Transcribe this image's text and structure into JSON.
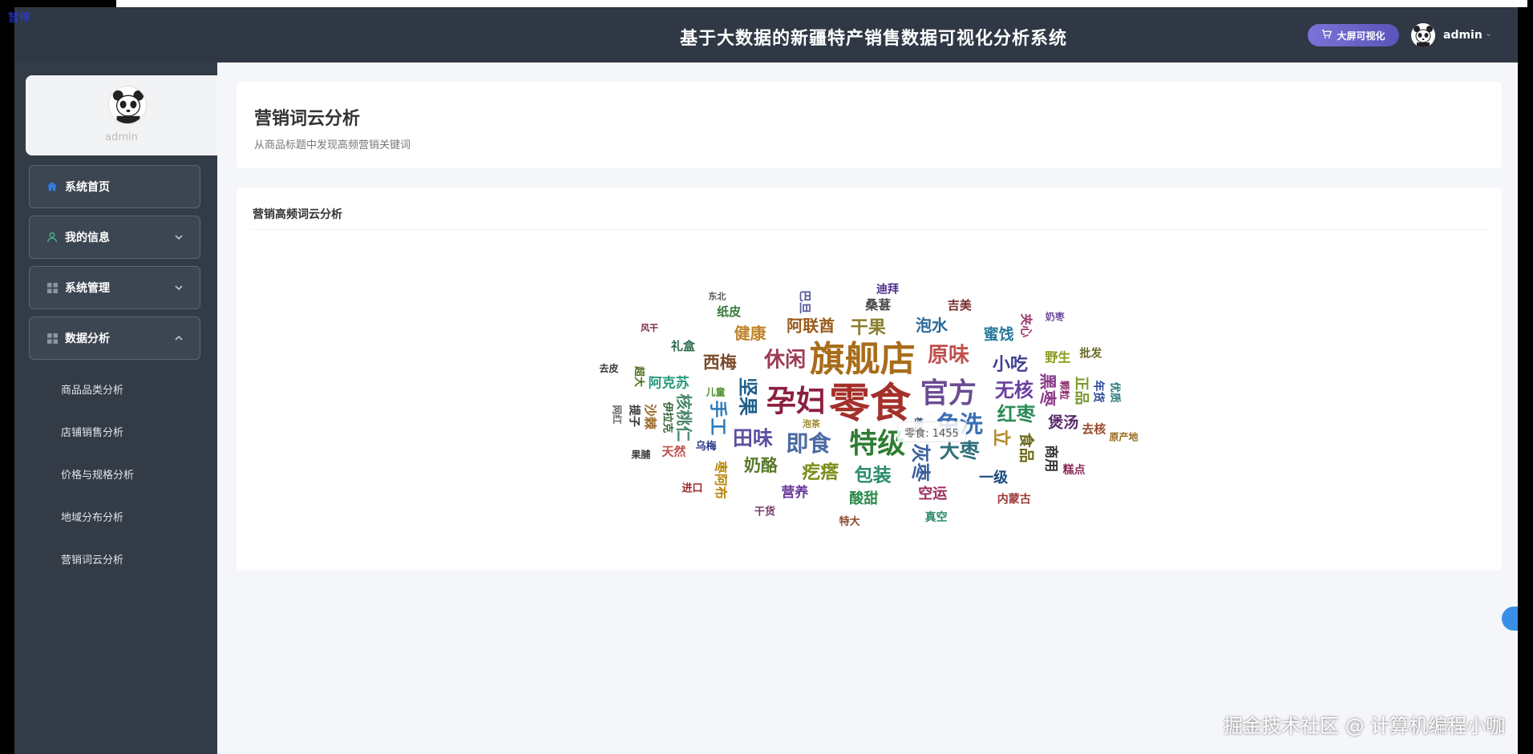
{
  "overlay": {
    "pause_label": "暂停",
    "watermark": "掘金技术社区 @ 计算机编程小咖"
  },
  "header": {
    "title": "基于大数据的新疆特产销售数据可视化分析系统",
    "bigscreen_label": "大屏可视化",
    "username": "admin"
  },
  "sidebar": {
    "profile_name": "admin",
    "menu": [
      {
        "label": "系统首页",
        "icon": "home-icon",
        "active": true
      },
      {
        "label": "我的信息",
        "icon": "user-icon",
        "expanded": false
      },
      {
        "label": "系统管理",
        "icon": "grid-icon",
        "expanded": false
      },
      {
        "label": "数据分析",
        "icon": "grid-icon",
        "expanded": true
      }
    ],
    "submenu": [
      {
        "label": "商品品类分析"
      },
      {
        "label": "店铺销售分析"
      },
      {
        "label": "价格与规格分析"
      },
      {
        "label": "地域分布分析"
      },
      {
        "label": "营销词云分析"
      }
    ]
  },
  "page": {
    "title": "营销词云分析",
    "subtitle": "从商品标题中发现高频营销关键词"
  },
  "section": {
    "title": "营销高频词云分析"
  },
  "tooltip": {
    "text": "零食: 1455"
  },
  "chart_data": {
    "type": "wordcloud",
    "words": [
      {
        "text": "零食",
        "value": 1455,
        "color": "#a4302b"
      },
      {
        "text": "旗舰店",
        "value": 1200,
        "color": "#a86d1a"
      },
      {
        "text": "孕妇",
        "value": 950,
        "color": "#8c1f3f"
      },
      {
        "text": "官方",
        "value": 900,
        "color": "#6a4c93"
      },
      {
        "text": "特级",
        "value": 880,
        "color": "#2e7d32"
      },
      {
        "text": "免洗",
        "value": 700,
        "color": "#3b6fb6"
      },
      {
        "text": "即食",
        "value": 650,
        "color": "#4a6aa3"
      },
      {
        "text": "休闲",
        "value": 600,
        "color": "#9c3d54"
      },
      {
        "text": "原味",
        "value": 580,
        "color": "#c0504d"
      },
      {
        "text": "大枣",
        "value": 560,
        "color": "#2f6f7a"
      },
      {
        "text": "田味",
        "value": 540,
        "color": "#5e4fa2"
      },
      {
        "text": "坚果",
        "value": 530,
        "color": "#1f5f8b"
      },
      {
        "text": "无核",
        "value": 520,
        "color": "#6b3fa0"
      },
      {
        "text": "红枣",
        "value": 510,
        "color": "#2e8b57"
      },
      {
        "text": "灰枣",
        "value": 500,
        "color": "#3a5f9e"
      },
      {
        "text": "包装",
        "value": 480,
        "color": "#2a8c6a"
      },
      {
        "text": "疙瘩",
        "value": 470,
        "color": "#7a8f1a"
      },
      {
        "text": "手工",
        "value": 460,
        "color": "#2b7bbb"
      },
      {
        "text": "干果",
        "value": 450,
        "color": "#8b7d2a"
      },
      {
        "text": "小吃",
        "value": 440,
        "color": "#3f3f8f"
      },
      {
        "text": "立",
        "value": 430,
        "color": "#b08a2a"
      },
      {
        "text": "奶酪",
        "value": 420,
        "color": "#5a7a2a"
      },
      {
        "text": "西梅",
        "value": 410,
        "color": "#7a4a2a"
      },
      {
        "text": "黑枣",
        "value": 400,
        "color": "#8a3a8a"
      },
      {
        "text": "阿联酋",
        "value": 390,
        "color": "#9a5a1a"
      },
      {
        "text": "泡水",
        "value": 380,
        "color": "#2a6a9a"
      },
      {
        "text": "核桃仁",
        "value": 370,
        "color": "#4a8a6a"
      },
      {
        "text": "健康",
        "value": 360,
        "color": "#c0842a"
      },
      {
        "text": "蜜饯",
        "value": 350,
        "color": "#2a7a9a"
      },
      {
        "text": "食品",
        "value": 340,
        "color": "#6a6a1a"
      },
      {
        "text": "煲汤",
        "value": 330,
        "color": "#5a2a6a"
      },
      {
        "text": "一级",
        "value": 320,
        "color": "#1a4a7a"
      },
      {
        "text": "正品",
        "value": 310,
        "color": "#7a9a2a"
      },
      {
        "text": "空运",
        "value": 300,
        "color": "#9a2a5a"
      },
      {
        "text": "酸甜",
        "value": 290,
        "color": "#2a8a4a"
      },
      {
        "text": "商用",
        "value": 280,
        "color": "#333333"
      },
      {
        "text": "营养",
        "value": 270,
        "color": "#6a3a9a"
      },
      {
        "text": "阿克苏",
        "value": 260,
        "color": "#2a9a7a"
      },
      {
        "text": "枣阿布",
        "value": 250,
        "color": "#b8860b"
      },
      {
        "text": "桑葚",
        "value": 240,
        "color": "#4a4a4a"
      },
      {
        "text": "野生",
        "value": 230,
        "color": "#8a9a1a"
      },
      {
        "text": "沙棘",
        "value": 220,
        "color": "#9a6a2a"
      },
      {
        "text": "天然",
        "value": 215,
        "color": "#c0504d"
      },
      {
        "text": "礼盒",
        "value": 210,
        "color": "#2a6a4a"
      },
      {
        "text": "巴旦",
        "value": 205,
        "color": "#5a5a9a"
      },
      {
        "text": "吉美",
        "value": 200,
        "color": "#7a2a2a"
      },
      {
        "text": "去核",
        "value": 195,
        "color": "#9a4a2a"
      },
      {
        "text": "夹心",
        "value": 190,
        "color": "#a03a6a"
      },
      {
        "text": "纸皮",
        "value": 185,
        "color": "#3a7a3a"
      },
      {
        "text": "迪拜",
        "value": 180,
        "color": "#4a2a8a"
      },
      {
        "text": "年货",
        "value": 175,
        "color": "#2a4a9a"
      },
      {
        "text": "批发",
        "value": 170,
        "color": "#6a6a2a"
      },
      {
        "text": "内蒙古",
        "value": 165,
        "color": "#9a3a3a"
      },
      {
        "text": "提子",
        "value": 160,
        "color": "#333333"
      },
      {
        "text": "糕点",
        "value": 155,
        "color": "#8a2a5a"
      },
      {
        "text": "真空",
        "value": 150,
        "color": "#2a8a6a"
      },
      {
        "text": "伊拉克",
        "value": 145,
        "color": "#3a6a3a"
      },
      {
        "text": "乌梅",
        "value": 140,
        "color": "#2a3a8a"
      },
      {
        "text": "特大",
        "value": 135,
        "color": "#8a4a2a"
      },
      {
        "text": "超大",
        "value": 130,
        "color": "#4a6a1a"
      },
      {
        "text": "干货",
        "value": 125,
        "color": "#7a3a6a"
      },
      {
        "text": "进口",
        "value": 120,
        "color": "#9a2a2a"
      },
      {
        "text": "优质",
        "value": 115,
        "color": "#2a7a7a"
      },
      {
        "text": "儿童",
        "value": 110,
        "color": "#4a8a2a"
      },
      {
        "text": "果脯",
        "value": 105,
        "color": "#3a3a3a"
      },
      {
        "text": "颗粒",
        "value": 100,
        "color": "#8a2a6a"
      },
      {
        "text": "奶枣",
        "value": 95,
        "color": "#6a4a9a"
      },
      {
        "text": "原产地",
        "value": 90,
        "color": "#9a6a1a"
      },
      {
        "text": "网红",
        "value": 85,
        "color": "#6a6a6a"
      },
      {
        "text": "去皮",
        "value": 80,
        "color": "#3a3a3a"
      },
      {
        "text": "泡茶",
        "value": 75,
        "color": "#9a8a2a"
      },
      {
        "text": "桂圆",
        "value": 70,
        "color": "#2a4a7a"
      },
      {
        "text": "风干",
        "value": 65,
        "color": "#7a2a4a"
      },
      {
        "text": "东北",
        "value": 60,
        "color": "#5a5a5a"
      }
    ]
  }
}
